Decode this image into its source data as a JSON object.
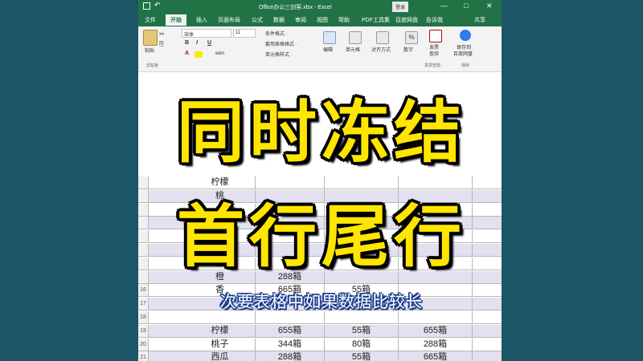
{
  "app": {
    "title": "Office办公三剑客.xlsx - Excel",
    "login": "登录",
    "qat_undo": "↶",
    "window_buttons": [
      "—",
      "□",
      "✕"
    ]
  },
  "tabs": [
    "文件",
    "开始",
    "插入",
    "页面布局",
    "公式",
    "数据",
    "审阅",
    "视图",
    "帮助",
    "PDF工具集",
    "百度网盘",
    "告诉我",
    "共享"
  ],
  "active_tab": "开始",
  "ribbon": {
    "paste_label": "粘贴",
    "clipboard_group": "剪贴板",
    "font_name": "宋体",
    "font_size": "11",
    "bold": "B",
    "italic": "I",
    "underline": "U",
    "wen": "wén",
    "conditional_format": "条件格式 ·",
    "table_format": "套用表格格式 ·",
    "cell_style": "单元格样式 ·",
    "editing": "编辑",
    "cells": "单元格",
    "alignment": "对齐方式",
    "number": "数字",
    "invoice_check_line1": "发票",
    "invoice_check_line2": "查验",
    "invoice_group": "发票查验",
    "save_to_line1": "保存到",
    "save_to_line2": "百度网盘",
    "save_group": "保存"
  },
  "rows": [
    {
      "num": "",
      "c1": "柠檬",
      "c2": "",
      "c3": "",
      "c4": "",
      "band": false
    },
    {
      "num": "",
      "c1": "桃",
      "c2": "",
      "c3": "",
      "c4": "",
      "band": true
    },
    {
      "num": "",
      "c1": "",
      "c2": "",
      "c3": "",
      "c4": "",
      "band": false
    },
    {
      "num": "",
      "c1": "",
      "c2": "",
      "c3": "",
      "c4": "",
      "band": true
    },
    {
      "num": "",
      "c1": "",
      "c2": "",
      "c3": "",
      "c4": "",
      "band": false
    },
    {
      "num": "",
      "c1": "橙",
      "c2": "",
      "c3": "",
      "c4": "",
      "band": true
    },
    {
      "num": "",
      "c1": "香",
      "c2": "",
      "c3": "",
      "c4": "",
      "band": false
    },
    {
      "num": "",
      "c1": "橙",
      "c2": "288箱",
      "c3": "",
      "c4": "",
      "band": true
    },
    {
      "num": "16",
      "c1": "香",
      "c2": "665箱",
      "c3": "55箱",
      "c4": "",
      "band": false
    },
    {
      "num": "17",
      "c1": "",
      "c2": "",
      "c3": "",
      "c4": "",
      "band": true
    },
    {
      "num": "18",
      "c1": "",
      "c2": "",
      "c3": "",
      "c4": "",
      "band": false
    },
    {
      "num": "19",
      "c1": "柠檬",
      "c2": "655箱",
      "c3": "55箱",
      "c4": "655箱",
      "band": true
    },
    {
      "num": "20",
      "c1": "桃子",
      "c2": "344箱",
      "c3": "80箱",
      "c4": "288箱",
      "band": false
    },
    {
      "num": "21",
      "c1": "西瓜",
      "c2": "288箱",
      "c3": "55箱",
      "c4": "665箱",
      "band": true
    },
    {
      "num": "22",
      "c1": "",
      "c2": "",
      "c3": "",
      "c4": "",
      "band": false
    }
  ],
  "overlay": {
    "line1": "同时冻结",
    "line2": "首行尾行",
    "subtitle": "次要表格中如果数据比较长"
  },
  "colors": {
    "excel_green": "#217346",
    "headline_yellow": "#ffe600",
    "background_teal": "#1b5566",
    "band_row": "#e3e0ef"
  }
}
